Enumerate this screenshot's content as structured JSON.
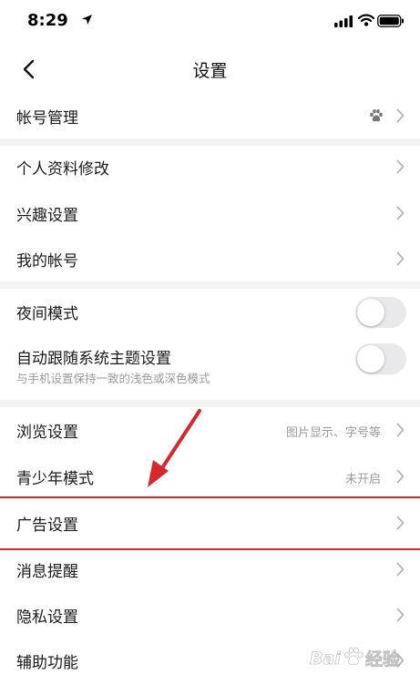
{
  "status_bar": {
    "time": "8:29"
  },
  "nav": {
    "title": "设置"
  },
  "rows": {
    "account_mgmt": {
      "label": "帐号管理"
    },
    "profile_edit": {
      "label": "个人资料修改"
    },
    "interest": {
      "label": "兴趣设置"
    },
    "my_account": {
      "label": "我的帐号"
    },
    "night_mode": {
      "label": "夜间模式",
      "enabled": false
    },
    "follow_theme": {
      "label": "自动跟随系统主题设置",
      "subtitle": "与手机设置保持一致的浅色或深色模式",
      "enabled": false
    },
    "browse": {
      "label": "浏览设置",
      "value": "图片显示、字号等"
    },
    "teen_mode": {
      "label": "青少年模式",
      "value": "未开启"
    },
    "ads": {
      "label": "广告设置"
    },
    "notifications": {
      "label": "消息提醒"
    },
    "privacy": {
      "label": "隐私设置"
    },
    "accessibility": {
      "label": "辅助功能"
    }
  },
  "watermark": {
    "text": "Bai 经验"
  },
  "colors": {
    "annotation_red": "#d9262d",
    "section_gap": "#f3f3f3",
    "secondary_text": "#9a9a9a",
    "toggle_off": "#e9e9eb"
  }
}
